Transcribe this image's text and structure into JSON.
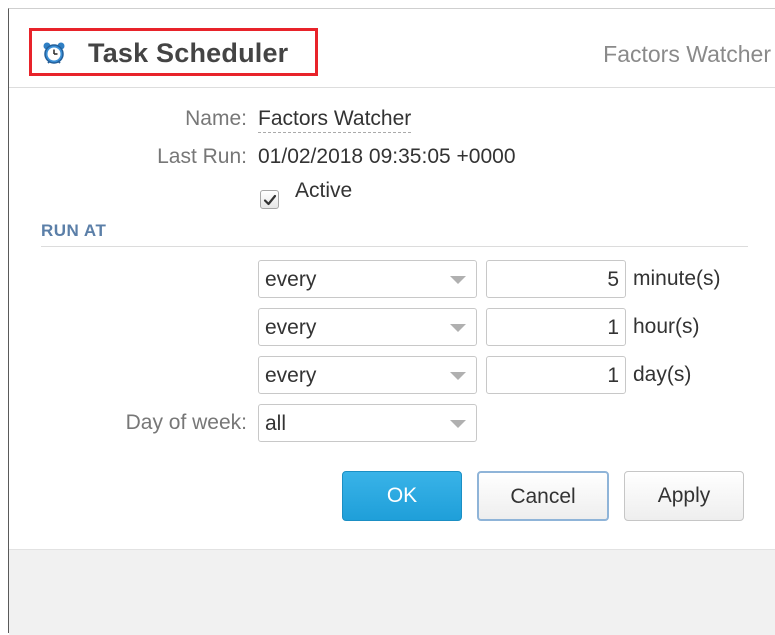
{
  "header": {
    "title": "Task Scheduler",
    "right_text": "Factors Watcher",
    "icon": "alarm-clock-icon",
    "highlight_color": "#e8232a"
  },
  "fields": {
    "name_label": "Name:",
    "name_value": "Factors Watcher",
    "last_run_label": "Last Run:",
    "last_run_value": "01/02/2018 09:35:05 +0000",
    "active_label": "Active",
    "active_checked": true
  },
  "run_at": {
    "section_title": "RUN AT",
    "rows": [
      {
        "mode": "every",
        "value": "5",
        "unit": "minute(s)"
      },
      {
        "mode": "every",
        "value": "1",
        "unit": "hour(s)"
      },
      {
        "mode": "every",
        "value": "1",
        "unit": "day(s)"
      }
    ],
    "day_of_week_label": "Day of week:",
    "day_of_week_value": "all"
  },
  "buttons": {
    "ok": "OK",
    "cancel": "Cancel",
    "apply": "Apply"
  },
  "colors": {
    "primary": "#1f9fd9",
    "section_title": "#5b7fa8"
  }
}
